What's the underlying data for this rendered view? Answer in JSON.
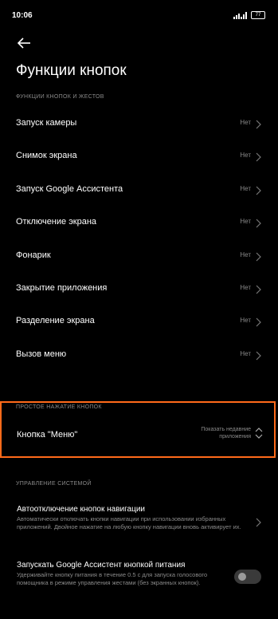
{
  "status_bar": {
    "time": "10:06",
    "battery": "77"
  },
  "page": {
    "title": "Функции кнопок"
  },
  "section_gestures": {
    "header": "ФУНКЦИИ КНОПОК И ЖЕСТОВ",
    "items": [
      {
        "label": "Запуск камеры",
        "value": "Нет"
      },
      {
        "label": "Снимок экрана",
        "value": "Нет"
      },
      {
        "label": "Запуск Google Ассистента",
        "value": "Нет"
      },
      {
        "label": "Отключение экрана",
        "value": "Нет"
      },
      {
        "label": "Фонарик",
        "value": "Нет"
      },
      {
        "label": "Закрытие приложения",
        "value": "Нет"
      },
      {
        "label": "Разделение экрана",
        "value": "Нет"
      },
      {
        "label": "Вызов меню",
        "value": "Нет"
      }
    ]
  },
  "section_simple_press": {
    "header": "ПРОСТОЕ НАЖАТИЕ КНОПОК",
    "menu_button": {
      "label": "Кнопка \"Меню\"",
      "value": "Показать недавние приложения"
    }
  },
  "section_system": {
    "header": "УПРАВЛЕНИЕ СИСТЕМОЙ",
    "auto_disable": {
      "title": "Автоотключение кнопок навигации",
      "description": "Автоматически отключать кнопки навигации при использовании избранных приложений. Двойное нажатие на любую кнопку навигации вновь активирует их."
    },
    "assistant_power": {
      "title": "Запускать Google Ассистент кнопкой питания",
      "description": "Удерживайте кнопку питания в течение 0.5 с для запуска голосового помощника в режиме управления жестами (без экранных кнопок).",
      "enabled": false
    }
  },
  "colors": {
    "background": "#000000",
    "text": "#ffffff",
    "secondary": "#8a8a8a",
    "highlight": "#ff6a1a"
  }
}
